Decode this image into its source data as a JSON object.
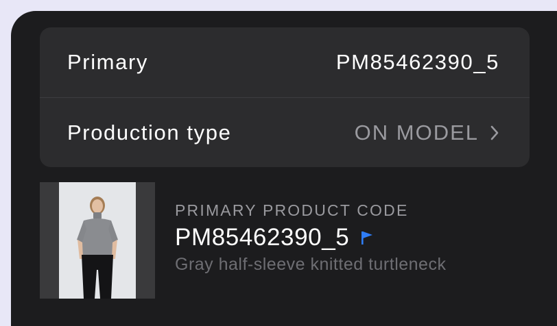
{
  "summary_card": {
    "primary_label": "Primary",
    "primary_value": "PM85462390_5",
    "production_type_label": "Production type",
    "production_type_value": "ON MODEL"
  },
  "product": {
    "code_label": "PRIMARY PRODUCT CODE",
    "code": "PM85462390_5",
    "description": "Gray half-sleeve knitted turtleneck",
    "flag_icon": "flag-icon",
    "flag_color": "#2f7df6"
  },
  "colors": {
    "page_bg": "#e8e7f7",
    "panel_bg": "#1c1c1e",
    "card_bg": "#2c2c2e",
    "muted_text": "#9a9a9f"
  }
}
